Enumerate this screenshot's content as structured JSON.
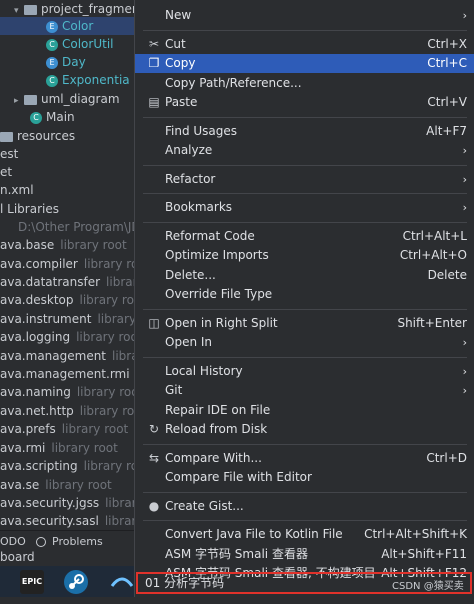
{
  "tree": {
    "rows": [
      {
        "text": "project_fragmen",
        "muted": "",
        "kind": "folder-open",
        "indent": 14,
        "sel": false
      },
      {
        "text": "Color",
        "muted": "",
        "kind": "enum",
        "indent": 46,
        "sel": true
      },
      {
        "text": "ColorUtil",
        "muted": "",
        "kind": "class",
        "indent": 46,
        "sel": false
      },
      {
        "text": "Day",
        "muted": "",
        "kind": "enum",
        "indent": 46,
        "sel": false
      },
      {
        "text": "Exponentia",
        "muted": "",
        "kind": "class",
        "indent": 46,
        "sel": false
      },
      {
        "text": "uml_diagram",
        "muted": "",
        "kind": "folder",
        "indent": 14,
        "sel": false
      },
      {
        "text": "Main",
        "muted": "",
        "kind": "class",
        "indent": 30,
        "sel": false
      },
      {
        "text": "resources",
        "muted": "",
        "kind": "folder-plain",
        "indent": 0,
        "sel": false
      },
      {
        "text": "est",
        "muted": "",
        "kind": "plain",
        "indent": 0,
        "sel": false
      },
      {
        "text": "et",
        "muted": "",
        "kind": "plain",
        "indent": 0,
        "sel": false
      },
      {
        "text": "n.xml",
        "muted": "",
        "kind": "plain",
        "indent": 0,
        "sel": false
      },
      {
        "text": "l Libraries",
        "muted": "",
        "kind": "plain",
        "indent": 0,
        "sel": false
      },
      {
        "text": "D:\\Other Program\\JD",
        "muted": "",
        "kind": "muted-only",
        "indent": 18,
        "sel": false
      },
      {
        "text": "ava.base",
        "muted": "library root",
        "kind": "plain",
        "indent": 0,
        "sel": false
      },
      {
        "text": "ava.compiler",
        "muted": "library root",
        "kind": "plain",
        "indent": 0,
        "sel": false
      },
      {
        "text": "ava.datatransfer",
        "muted": "library root",
        "kind": "plain",
        "indent": 0,
        "sel": false
      },
      {
        "text": "ava.desktop",
        "muted": "library root",
        "kind": "plain",
        "indent": 0,
        "sel": false
      },
      {
        "text": "ava.instrument",
        "muted": "library root",
        "kind": "plain",
        "indent": 0,
        "sel": false
      },
      {
        "text": "ava.logging",
        "muted": "library root",
        "kind": "plain",
        "indent": 0,
        "sel": false
      },
      {
        "text": "ava.management",
        "muted": "library r",
        "kind": "plain",
        "indent": 0,
        "sel": false
      },
      {
        "text": "ava.management.rmi",
        "muted": "li",
        "kind": "plain",
        "indent": 0,
        "sel": false
      },
      {
        "text": "ava.naming",
        "muted": "library root",
        "kind": "plain",
        "indent": 0,
        "sel": false
      },
      {
        "text": "ava.net.http",
        "muted": "library root",
        "kind": "plain",
        "indent": 0,
        "sel": false
      },
      {
        "text": "ava.prefs",
        "muted": "library root",
        "kind": "plain",
        "indent": 0,
        "sel": false
      },
      {
        "text": "ava.rmi",
        "muted": "library root",
        "kind": "plain",
        "indent": 0,
        "sel": false
      },
      {
        "text": "ava.scripting",
        "muted": "library root",
        "kind": "plain",
        "indent": 0,
        "sel": false
      },
      {
        "text": "ava.se",
        "muted": "library root",
        "kind": "plain",
        "indent": 0,
        "sel": false
      },
      {
        "text": "ava.security.jgss",
        "muted": "library roo",
        "kind": "plain",
        "indent": 0,
        "sel": false
      },
      {
        "text": "ava.security.sasl",
        "muted": "library roo",
        "kind": "plain",
        "indent": 0,
        "sel": false
      }
    ]
  },
  "toolstrip": {
    "todo": "ODO",
    "problems": "Problems",
    "board": "board"
  },
  "taskbar": {
    "epic": "EPIC"
  },
  "menu": {
    "items": [
      {
        "label": "New",
        "shortcut": "",
        "submenu": true,
        "icon": "",
        "highlight": false
      },
      {
        "sep": true
      },
      {
        "label": "Cut",
        "shortcut": "Ctrl+X",
        "submenu": false,
        "icon": "scissors-icon",
        "highlight": false
      },
      {
        "label": "Copy",
        "shortcut": "Ctrl+C",
        "submenu": false,
        "icon": "copy-icon",
        "highlight": true
      },
      {
        "label": "Copy Path/Reference...",
        "shortcut": "",
        "submenu": false,
        "icon": "",
        "highlight": false
      },
      {
        "label": "Paste",
        "shortcut": "Ctrl+V",
        "submenu": false,
        "icon": "paste-icon",
        "highlight": false
      },
      {
        "sep": true
      },
      {
        "label": "Find Usages",
        "shortcut": "Alt+F7",
        "submenu": false,
        "icon": "",
        "highlight": false
      },
      {
        "label": "Analyze",
        "shortcut": "",
        "submenu": true,
        "icon": "",
        "highlight": false
      },
      {
        "sep": true
      },
      {
        "label": "Refactor",
        "shortcut": "",
        "submenu": true,
        "icon": "",
        "highlight": false
      },
      {
        "sep": true
      },
      {
        "label": "Bookmarks",
        "shortcut": "",
        "submenu": true,
        "icon": "",
        "highlight": false
      },
      {
        "sep": true
      },
      {
        "label": "Reformat Code",
        "shortcut": "Ctrl+Alt+L",
        "submenu": false,
        "icon": "",
        "highlight": false
      },
      {
        "label": "Optimize Imports",
        "shortcut": "Ctrl+Alt+O",
        "submenu": false,
        "icon": "",
        "highlight": false
      },
      {
        "label": "Delete...",
        "shortcut": "Delete",
        "submenu": false,
        "icon": "",
        "highlight": false
      },
      {
        "label": "Override File Type",
        "shortcut": "",
        "submenu": false,
        "icon": "",
        "highlight": false
      },
      {
        "sep": true
      },
      {
        "label": "Open in Right Split",
        "shortcut": "Shift+Enter",
        "submenu": false,
        "icon": "split-icon",
        "highlight": false
      },
      {
        "label": "Open In",
        "shortcut": "",
        "submenu": true,
        "icon": "",
        "highlight": false
      },
      {
        "sep": true
      },
      {
        "label": "Local History",
        "shortcut": "",
        "submenu": true,
        "icon": "",
        "highlight": false
      },
      {
        "label": "Git",
        "shortcut": "",
        "submenu": true,
        "icon": "",
        "highlight": false
      },
      {
        "label": "Repair IDE on File",
        "shortcut": "",
        "submenu": false,
        "icon": "",
        "highlight": false
      },
      {
        "label": "Reload from Disk",
        "shortcut": "",
        "submenu": false,
        "icon": "reload-icon",
        "highlight": false
      },
      {
        "sep": true
      },
      {
        "label": "Compare With...",
        "shortcut": "Ctrl+D",
        "submenu": false,
        "icon": "compare-icon",
        "highlight": false
      },
      {
        "label": "Compare File with Editor",
        "shortcut": "",
        "submenu": false,
        "icon": "",
        "highlight": false
      },
      {
        "sep": true
      },
      {
        "label": "Create Gist...",
        "shortcut": "",
        "submenu": false,
        "icon": "github-icon",
        "highlight": false
      },
      {
        "sep": true
      },
      {
        "label": "Convert Java File to Kotlin File",
        "shortcut": "Ctrl+Alt+Shift+K",
        "submenu": false,
        "icon": "",
        "highlight": false
      },
      {
        "label": "ASM 字节码 Smali 查看器",
        "shortcut": "Alt+Shift+F11",
        "submenu": false,
        "icon": "",
        "highlight": false
      },
      {
        "label": "ASM 字节码 Smali 查看器, 不构建项目",
        "shortcut": "Alt+Shift+F12",
        "submenu": false,
        "icon": "",
        "highlight": false
      }
    ],
    "boxed_item": {
      "label": "01 分析字节码"
    }
  },
  "watermark": "CSDN @猿买卖",
  "colors": {
    "highlight": "#2e5cb8",
    "box": "#e0322b",
    "selection": "#2e436e"
  }
}
